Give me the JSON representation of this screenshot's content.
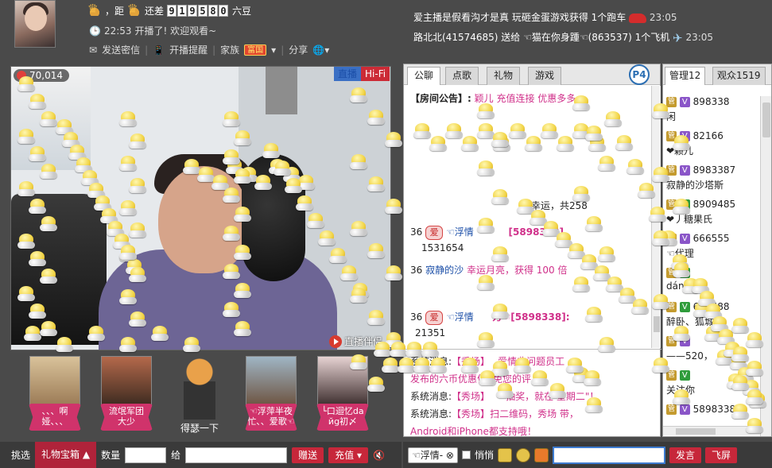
{
  "host": {
    "rank_text": "，距",
    "rank_suffix_text": "还差",
    "beans_digits": [
      "9",
      "1",
      "9",
      "5",
      "8",
      "0"
    ],
    "beans_unit": "六豆",
    "start_time": "22:53",
    "start_message": "开播了! 欢迎观看~"
  },
  "actions": {
    "send_message": "发送密信",
    "broadcast_reminder": "开播提醒",
    "family_label": "家族",
    "family_badge": "富国",
    "share": "分享"
  },
  "video": {
    "viewer_count": "70,014",
    "live_tag": "直播",
    "hifi_tag": "Hi-Fi",
    "accompany_label": "直播伴侣"
  },
  "fans": [
    {
      "name": "、、、啊\n娅、、、"
    },
    {
      "name": "流氓军团\n大少"
    },
    {
      "name": "得瑟一下"
    },
    {
      "name": "☜浮萍半夜\n忙、、爱歌☜"
    },
    {
      "name": "└口迴忆da\nйg初〆"
    }
  ],
  "gift_bar": {
    "pick_label": "挑选",
    "gift_box": "礼物宝箱",
    "quantity_label": "数量",
    "to_label": "给",
    "give_button": "赠送",
    "recharge_button": "充值"
  },
  "notices": [
    {
      "text": "爱主播是假看沟才是真 玩砸金蛋游戏获得 1个跑车",
      "time": "23:05"
    },
    {
      "text": "路北北(41574685) 送给 ☜猫在你身踵☜(863537) 1个飞机",
      "time": "23:05"
    }
  ],
  "chat_tabs": [
    "公聊",
    "点歌",
    "礼物",
    "游戏"
  ],
  "chat_extra_icon": "P4",
  "public_chat": {
    "announcement_label": "【房间公告】:",
    "announcement_text": "颖儿 充值连接 优惠多多",
    "lines": [
      {
        "t1": "幸运",
        "t2": "，共258"
      },
      {
        "t1": "36",
        "t2": "☜浮情",
        "t3": "[5898338]"
      },
      {
        "t1": "1531654"
      },
      {
        "t1": "36",
        "t2": "寂静的沙",
        "t3": "幸运月亮，获得 100 倍"
      },
      {
        "t1": "36",
        "t2": "☜浮情",
        "t3": "万☜[5898338]:"
      },
      {
        "t1": "21351"
      }
    ]
  },
  "system_msgs": [
    {
      "label": "系统消息:",
      "text": "【秀场】",
      "rest": "爱情非问题员工"
    },
    {
      "label": "发布的六币优惠信",
      "text": "",
      "rest": "免您的评 得!"
    },
    {
      "label": "系统消息:",
      "text": "【秀场】",
      "rest": "抽奖，就在 星期二\"！"
    },
    {
      "label": "系统消息:",
      "text": "【秀场】",
      "rest": "扫二维码，秀场 带，"
    },
    {
      "label": "Android和iPhone都支持哦！",
      "text": "",
      "rest": ""
    }
  ],
  "user_tabs": [
    "管理12",
    "观众1519"
  ],
  "users": [
    {
      "id": "898338",
      "extra": "闲"
    },
    {
      "id": "82166",
      "extra": "❤颖儿"
    },
    {
      "id": "8983387",
      "extra": "寂静的沙塔斯"
    },
    {
      "id": "8909485",
      "extra": "❤丿糖果氏"
    },
    {
      "id": "666555",
      "extra": "☜代理"
    },
    {
      "id": "",
      "extra": "dáng"
    },
    {
      "id": "691688",
      "extra": "醉卧、狐城"
    },
    {
      "id": "",
      "extra": "——520，"
    },
    {
      "id": "",
      "extra": "关注你"
    },
    {
      "id": "5898338",
      "extra": ""
    }
  ],
  "chat_bar": {
    "recipient": "☜浮情-",
    "whisper_label": "悄悄",
    "send_button": "发言",
    "fly_button": "飞屏"
  }
}
